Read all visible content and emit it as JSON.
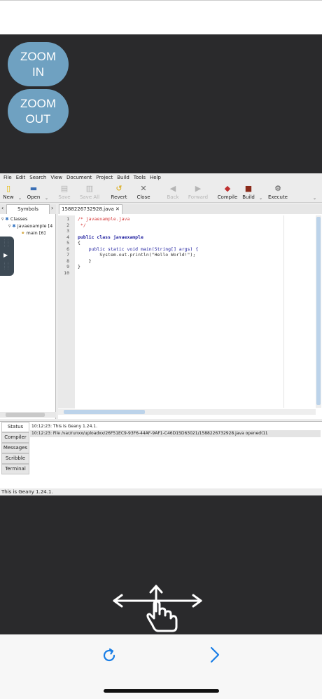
{
  "zoom": {
    "in_label": "ZOOM\nIN",
    "out_label": "ZOOM\nOUT"
  },
  "menu": [
    "File",
    "Edit",
    "Search",
    "View",
    "Document",
    "Project",
    "Build",
    "Tools",
    "Help"
  ],
  "toolbar": {
    "new": "New",
    "open": "Open",
    "save": "Save",
    "save_all": "Save All",
    "revert": "Revert",
    "close": "Close",
    "back": "Back",
    "forward": "Forward",
    "compile": "Compile",
    "build": "Build",
    "execute": "Execute"
  },
  "sidebar": {
    "tab": "Symbols",
    "tree": [
      "Classes",
      "javaexample [4",
      "main [6]"
    ]
  },
  "editor": {
    "tab": "1588226732928.java",
    "line_numbers": [
      "1",
      "2",
      "3",
      "4",
      "5",
      "6",
      "7",
      "8",
      "9",
      "10"
    ],
    "lines": [
      "/* javaexample.java",
      " */",
      "",
      "public class javaexample",
      "{",
      "    public static void main(String[] args) {",
      "        System.out.println(\"Hello World!\");",
      "    }",
      "}",
      ""
    ]
  },
  "messages": {
    "tabs": [
      "Status",
      "Compiler",
      "Messages",
      "Scribble",
      "Terminal"
    ],
    "lines": [
      "10:12:23: This is Geany 1.24.1.",
      "10:12:23: File /var/runxx/uploadxx/26F51EC9-93F6-44AF-9AF1-C46D15D63021/1588226732928.java opened(1)."
    ]
  },
  "statusbar": {
    "text": "This is Geany 1.24.1."
  },
  "icons": {
    "gesture": "pan-gesture-icon",
    "reload": "reload-icon",
    "next": "chevron-right-icon"
  },
  "colors": {
    "accent": "#1a7ee6",
    "zoom_button": "#6fa1c1",
    "dark_bg": "#2a2a2c",
    "comment": "#d63b3b",
    "keyword": "#1d1d9e",
    "string": "#e07a00"
  }
}
